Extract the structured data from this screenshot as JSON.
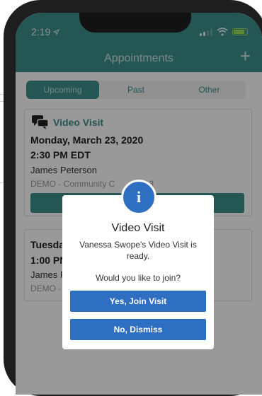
{
  "status_bar": {
    "time": "2:19"
  },
  "header": {
    "title": "Appointments",
    "add_label": "+"
  },
  "tabs": [
    {
      "label": "Upcoming",
      "active": true
    },
    {
      "label": "Past",
      "active": false
    },
    {
      "label": "Other",
      "active": false
    }
  ],
  "appointments": [
    {
      "type_label": "Video Visit",
      "date": "Monday, March 23, 2020",
      "time": "2:30 PM EDT",
      "provider": "James Peterson",
      "location": "DEMO - Community C",
      "location_suffix": "W 3"
    },
    {
      "date": "Tuesda",
      "time": "1:00 PN",
      "provider": "James P",
      "location": "DEMO -"
    }
  ],
  "dialog": {
    "title": "Video Visit",
    "message": "Vanessa Swope's Video Visit is ready.",
    "question": "Would you like to join?",
    "confirm_label": "Yes, Join Visit",
    "dismiss_label": "No, Dismiss"
  },
  "colors": {
    "teal": "#3d8f8d",
    "blue": "#2f6fc1"
  }
}
